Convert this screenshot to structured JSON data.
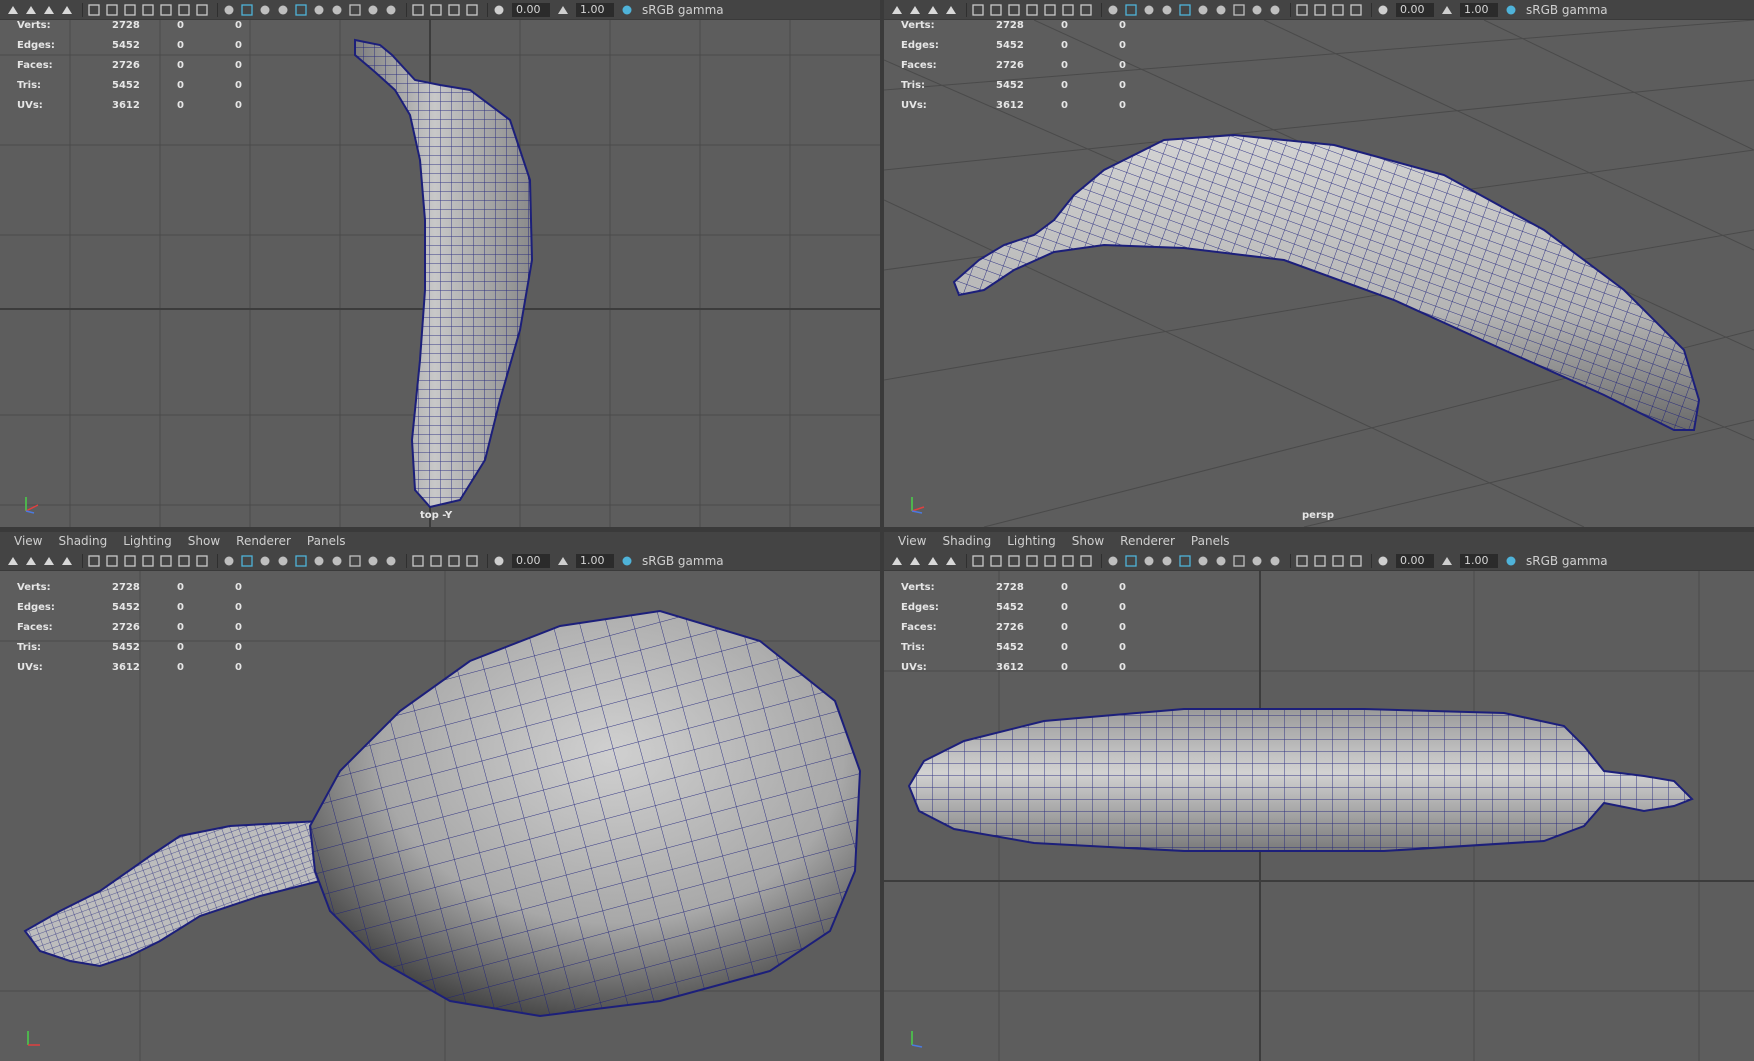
{
  "menu": [
    "View",
    "Shading",
    "Lighting",
    "Show",
    "Renderer",
    "Panels"
  ],
  "toolbar": {
    "exposure": "0.00",
    "gamma": "1.00",
    "colorspace": "sRGB gamma"
  },
  "hud_labels": [
    "Verts:",
    "Edges:",
    "Faces:",
    "Tris:",
    "UVs:"
  ],
  "hud_values": [
    [
      "2728",
      "0",
      "0"
    ],
    [
      "5452",
      "0",
      "0"
    ],
    [
      "2726",
      "0",
      "0"
    ],
    [
      "5452",
      "0",
      "0"
    ],
    [
      "3612",
      "0",
      "0"
    ]
  ],
  "panels": [
    {
      "camera": "top -Y"
    },
    {
      "camera": "persp"
    },
    {
      "camera": ""
    },
    {
      "camera": ""
    }
  ],
  "colors": {
    "viewport_bg": "#5d5d5d",
    "grid": "#4a4a4a",
    "grid_axis": "#3c3c3c",
    "wire": "#1c1f7a",
    "mesh_light": "#c9c9c9",
    "mesh_dark": "#5a5a5a"
  }
}
